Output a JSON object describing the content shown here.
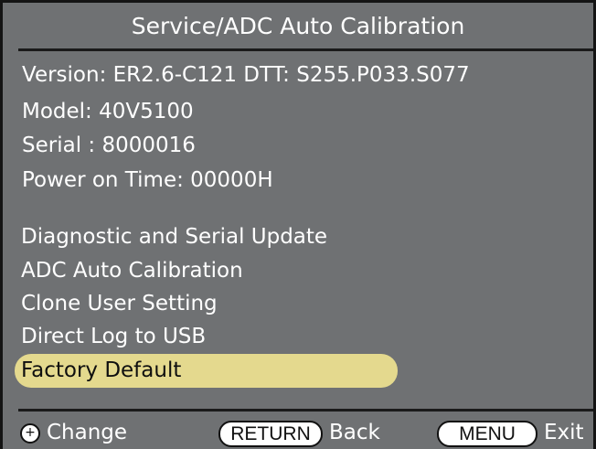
{
  "screen": {
    "title": "Service/ADC Auto Calibration"
  },
  "info": {
    "version": "Version: ER2.6-C121  DTT: S255.P033.S077",
    "model": "Model: 40V5100",
    "serial": "Serial :  8000016",
    "power_on_time": "Power on Time: 00000H"
  },
  "menu": {
    "items": [
      {
        "label": "Diagnostic and Serial Update"
      },
      {
        "label": "ADC Auto Calibration"
      },
      {
        "label": "Clone User Setting"
      },
      {
        "label": "Direct Log to USB"
      },
      {
        "label": "Factory Default"
      }
    ],
    "selected_label": "Factory Default"
  },
  "footer": {
    "change_icon": "navigation-dial-icon",
    "change_label": "Change",
    "return_key": "RETURN",
    "return_label": "Back",
    "menu_key": "MENU",
    "menu_label": "Exit"
  },
  "colors": {
    "background": "#6f7173",
    "highlight": "#e4d98e",
    "text": "#ffffff",
    "border": "#141414"
  }
}
